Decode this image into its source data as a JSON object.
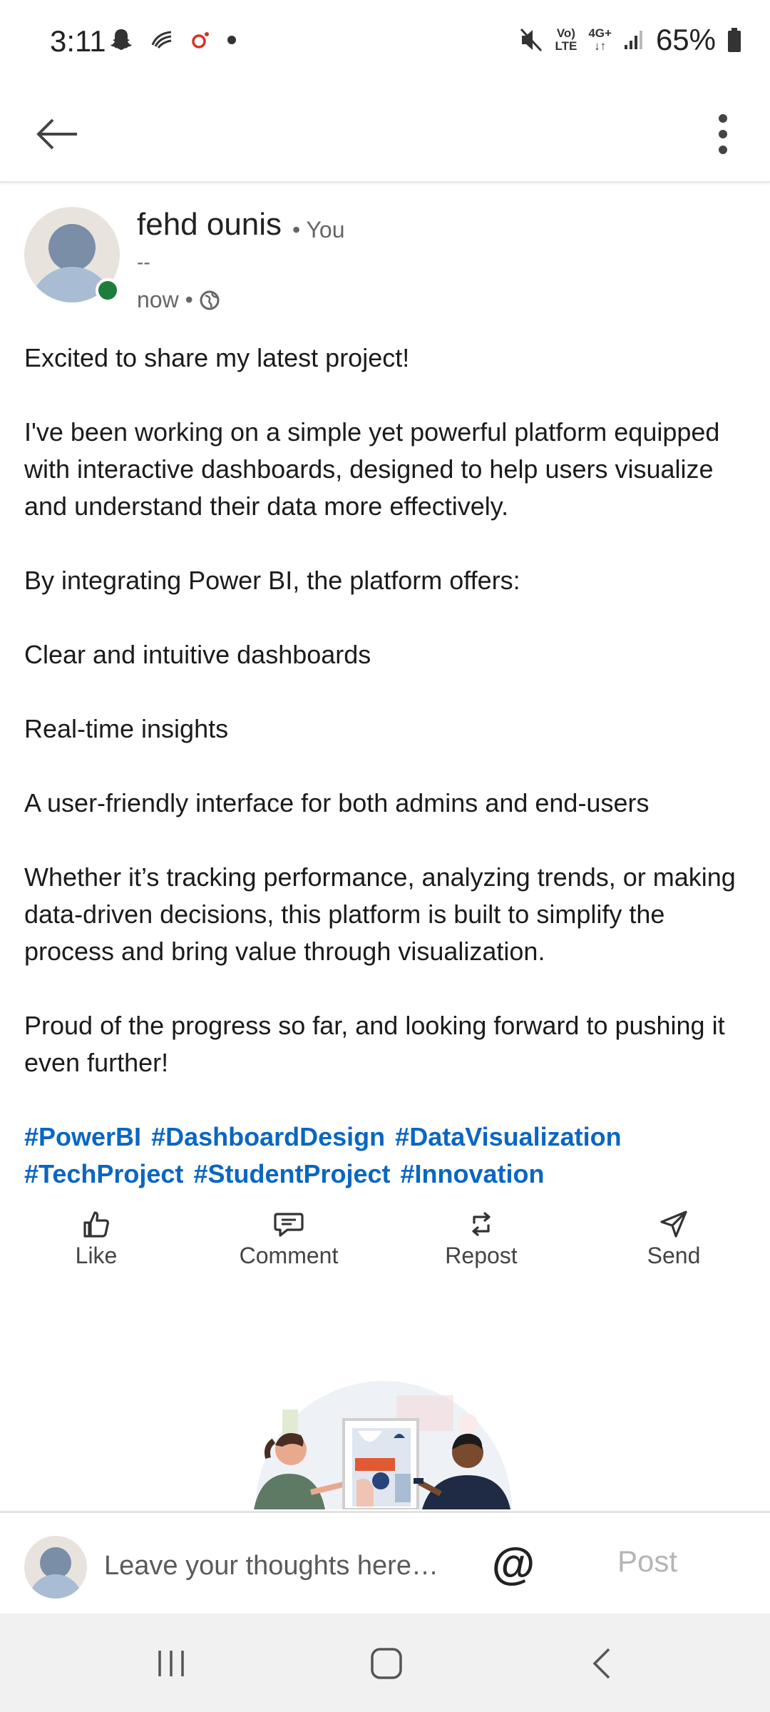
{
  "status_bar": {
    "time": "3:11",
    "network_top": "Vo)",
    "network_bottom": "LTE",
    "data_top": "4G+",
    "battery": "65%"
  },
  "app_bar": {
    "back_icon": "arrow-left-icon",
    "more_icon": "more-vertical-icon"
  },
  "post": {
    "author": "fehd ounis",
    "relation": "• You",
    "headline": "--",
    "time": "now •",
    "visibility_icon": "globe-icon",
    "paragraphs": [
      "Excited to share my latest project!",
      "I've been working on a simple yet powerful platform equipped with interactive dashboards, designed to help users visualize and understand their data more effectively.",
      "By integrating Power BI, the platform offers:",
      "Clear and intuitive dashboards",
      "Real-time insights",
      "A user-friendly interface for both admins and end-users",
      "Whether it’s tracking performance, analyzing trends, or making data-driven decisions, this platform is built to simplify the process and bring value through visualization.",
      "Proud of the progress so far, and looking forward to pushing it even further!"
    ],
    "hashtags": [
      "#PowerBI",
      "#DashboardDesign",
      "#DataVisualization",
      "#TechProject",
      "#StudentProject",
      "#Innovation"
    ]
  },
  "actions": {
    "like": "Like",
    "comment": "Comment",
    "repost": "Repost",
    "send": "Send"
  },
  "comment_bar": {
    "placeholder": "Leave your thoughts here…",
    "mention": "@",
    "post": "Post"
  },
  "colors": {
    "hashtag": "#0a66c2",
    "online": "#1d7d3a",
    "post_disabled": "#b5b5b5"
  }
}
